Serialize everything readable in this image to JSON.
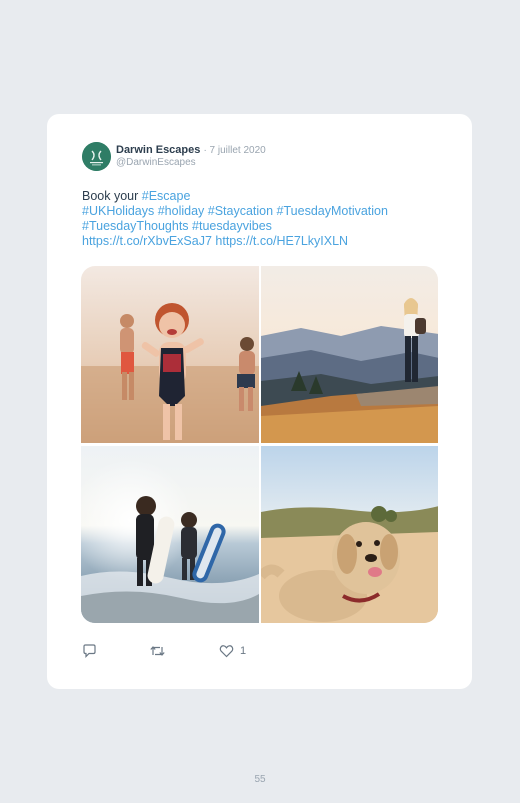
{
  "tweet": {
    "author_name": "Darwin Escapes",
    "date": "· 7 juillet 2020",
    "handle": "@DarwinEscapes",
    "text_prefix": "Book your ",
    "hashtag_escape": "#Escape",
    "hashtags_line2": "#UKHolidays #holiday #Staycation #TuesdayMotivation",
    "hashtags_line3": "#TuesdayThoughts #tuesdayvibes",
    "links_line4": "https://t.co/rXbvExSaJ7 https://t.co/HE7LkyIXLN",
    "like_count": "1",
    "photos": [
      "children-running-beach",
      "hiker-mountain-view",
      "kids-bodyboards-surf",
      "dog-on-beach"
    ]
  },
  "icons": [
    "reply-icon",
    "retweet-icon",
    "heart-icon",
    "brand-logo"
  ],
  "colors": {
    "page_background": "#e8ebef",
    "card_background": "#ffffff",
    "link": "#4aa3df",
    "brand_green": "#2f7d66"
  },
  "page_number": "55"
}
